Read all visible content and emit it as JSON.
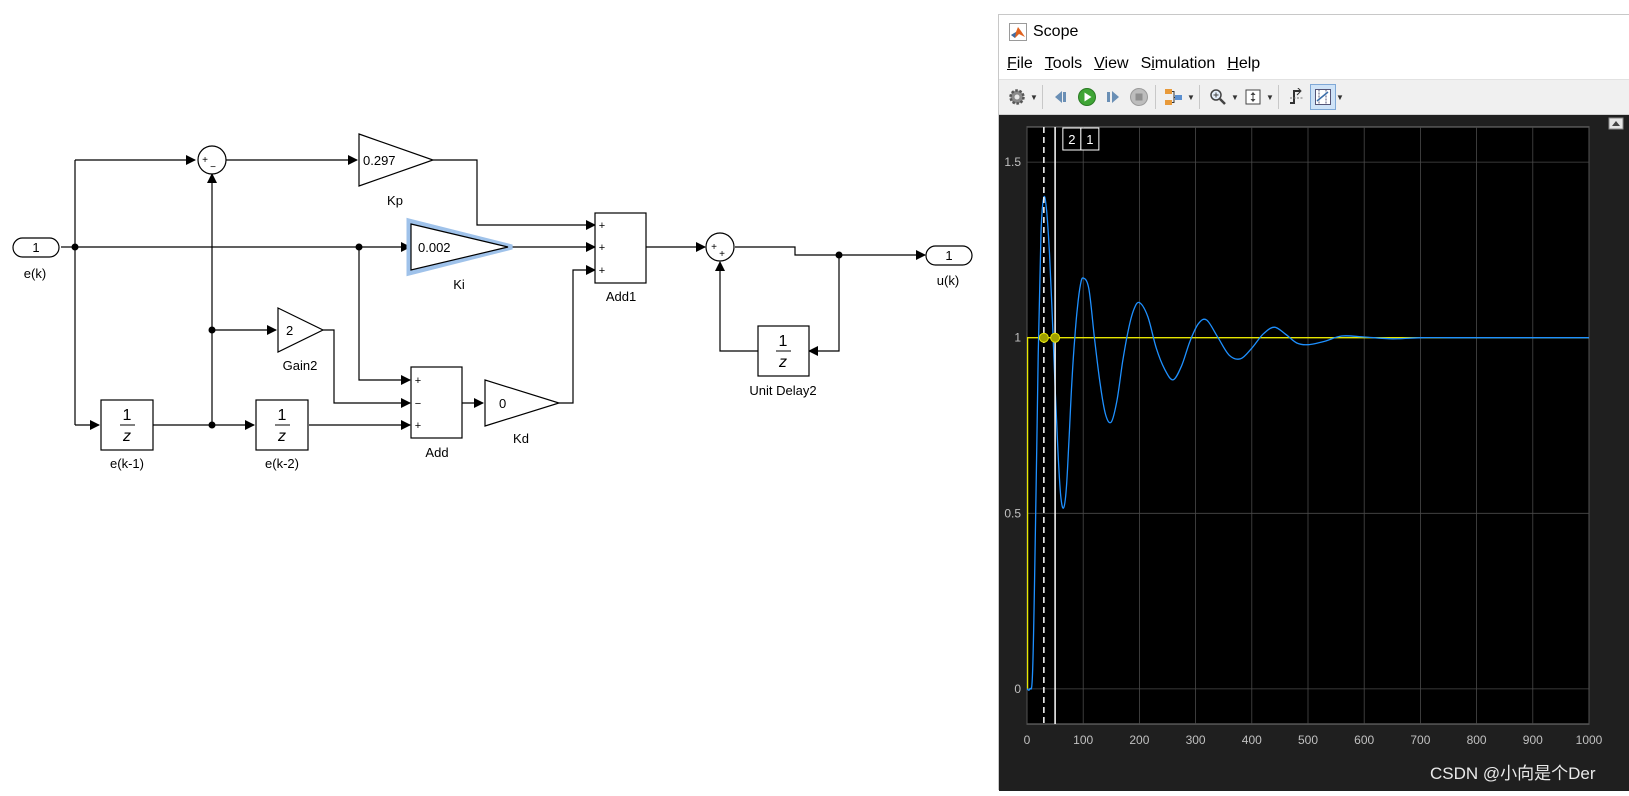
{
  "diagram": {
    "inport": {
      "number": "1",
      "label": "e(k)"
    },
    "outport": {
      "number": "1",
      "label": "u(k)"
    },
    "kp": {
      "value": "0.297",
      "label": "Kp"
    },
    "ki": {
      "value": "0.002",
      "label": "Ki"
    },
    "kd": {
      "value": "0",
      "label": "Kd"
    },
    "gain2": {
      "value": "2",
      "label": "Gain2"
    },
    "delay1": {
      "num": "1",
      "den": "z",
      "label": "e(k-1)"
    },
    "delay2": {
      "num": "1",
      "den": "z",
      "label": "e(k-2)"
    },
    "unit_delay2": {
      "num": "1",
      "den": "z",
      "label": "Unit Delay2"
    },
    "add": {
      "label": "Add",
      "signs": [
        "+",
        "−",
        "+"
      ]
    },
    "add1": {
      "label": "Add1",
      "signs": [
        "+",
        "+",
        "+"
      ]
    },
    "sum1": {
      "signs": [
        "+",
        "−"
      ]
    },
    "sum2": {
      "signs": [
        "+",
        "+"
      ]
    }
  },
  "scope": {
    "title": "Scope",
    "menu": [
      {
        "mnemonic": "F",
        "rest": "ile"
      },
      {
        "mnemonic": "T",
        "rest": "ools"
      },
      {
        "mnemonic": "V",
        "rest": "iew"
      },
      {
        "pre": "S",
        "mnemonic": "i",
        "rest": "mulation"
      },
      {
        "mnemonic": "H",
        "rest": "elp"
      }
    ],
    "toolbar_icons": [
      "settings-icon",
      "step-back-icon",
      "run-icon",
      "step-forward-icon",
      "stop-icon",
      "highlight-icon",
      "zoom-in-icon",
      "fit-to-view-icon",
      "triggers-icon",
      "cursor-measurements-icon"
    ],
    "cursor_labels": [
      "2",
      "1"
    ],
    "colors": {
      "background": "#000000",
      "grid": "#4a4a4a",
      "series_input": "#e6e600",
      "series_output": "#1e90ff",
      "axes_text": "#c0c0c0"
    }
  },
  "chart_data": {
    "type": "line",
    "xlim": [
      0,
      1000
    ],
    "ylim": [
      -0.1,
      1.6
    ],
    "xticks": [
      0,
      100,
      200,
      300,
      400,
      500,
      600,
      700,
      800,
      900,
      1000
    ],
    "yticks": [
      0,
      0.5,
      1,
      1.5
    ],
    "ytick_labels": [
      "0",
      "0.5",
      "1",
      "1.5"
    ],
    "grid": true,
    "series": [
      {
        "color": "#e6e600",
        "x": [
          0,
          1,
          1000
        ],
        "y": [
          0,
          1,
          1
        ]
      },
      {
        "color": "#1e90ff",
        "x": [
          0,
          5,
          10,
          15,
          20,
          25,
          30,
          35,
          40,
          45,
          50,
          55,
          60,
          65,
          70,
          75,
          80,
          85,
          90,
          95,
          100,
          110,
          120,
          130,
          140,
          150,
          160,
          170,
          180,
          190,
          200,
          215,
          230,
          245,
          260,
          275,
          290,
          305,
          320,
          340,
          360,
          380,
          400,
          420,
          440,
          460,
          480,
          500,
          530,
          560,
          600,
          650,
          700,
          750,
          800,
          850,
          900,
          950,
          1000
        ],
        "y": [
          0,
          0,
          0.05,
          0.45,
          0.95,
          1.3,
          1.4,
          1.36,
          1.24,
          1.06,
          0.86,
          0.68,
          0.55,
          0.515,
          0.57,
          0.72,
          0.88,
          1.0,
          1.09,
          1.15,
          1.17,
          1.14,
          1.0,
          0.87,
          0.78,
          0.76,
          0.82,
          0.93,
          1.02,
          1.08,
          1.1,
          1.06,
          0.97,
          0.91,
          0.88,
          0.92,
          0.99,
          1.04,
          1.05,
          1.0,
          0.95,
          0.94,
          0.97,
          1.01,
          1.03,
          1.01,
          0.985,
          0.98,
          0.99,
          1.005,
          1.002,
          0.997,
          1.0,
          1.0,
          1.0,
          1.0,
          1.0,
          1.0,
          1.0
        ]
      }
    ]
  },
  "watermark": "CSDN @小向是个Der"
}
